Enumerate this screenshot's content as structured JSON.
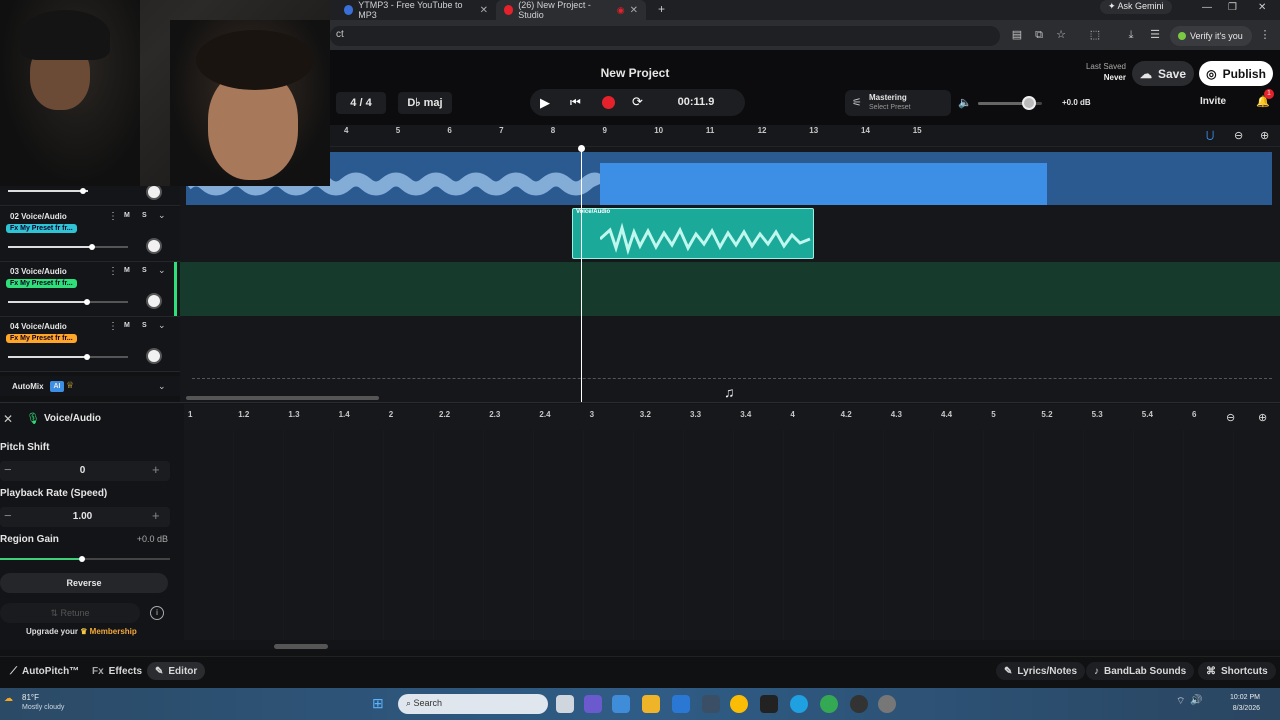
{
  "browser": {
    "tabs": [
      {
        "label": "YTMP3 - Free YouTube to MP3"
      },
      {
        "label": "(26) New Project - Studio"
      }
    ],
    "ask_gemini": "Ask Gemini",
    "url_fragment": "ct",
    "verify": "Verify it's you"
  },
  "header": {
    "title": "New Project",
    "last_saved_label": "Last Saved",
    "last_saved_value": "Never",
    "save": "Save",
    "publish": "Publish",
    "invite": "Invite",
    "notif_count": "1",
    "time_sig": "4 / 4",
    "key": "D♭ maj",
    "time": "00:11.9",
    "mastering_label": "Mastering",
    "mastering_sub": "Select Preset",
    "master_db": "+0.0 dB",
    "volume_level": 0.8
  },
  "ruler": {
    "ticks": [
      "4",
      "5",
      "6",
      "7",
      "8",
      "9",
      "10",
      "11",
      "12",
      "13",
      "14",
      "15"
    ]
  },
  "tracks": [
    {
      "name": "02 Voice/Audio",
      "fx": "Fx My Preset fr fr...",
      "m": "M",
      "s": "S",
      "color": "#2ec4d6",
      "volume": 0.7
    },
    {
      "name": "03 Voice/Audio",
      "fx": "Fx My Preset fr fr...",
      "m": "M",
      "s": "S",
      "color": "#2fe07a",
      "volume": 0.66
    },
    {
      "name": "04 Voice/Audio",
      "fx": "Fx My Preset fr fr...",
      "m": "M",
      "s": "S",
      "color": "#ffa528",
      "volume": 0.66
    }
  ],
  "clip_label": "Voice/Audio",
  "automix": "AutoMix",
  "automix_ai": "AI",
  "editor": {
    "track_title": "Voice/Audio",
    "ticks": [
      "1",
      "1.2",
      "1.3",
      "1.4",
      "2",
      "2.2",
      "2.3",
      "2.4",
      "3",
      "3.2",
      "3.3",
      "3.4",
      "4",
      "4.2",
      "4.3",
      "4.4",
      "5",
      "5.2",
      "5.3",
      "5.4",
      "6"
    ],
    "pitch_label": "Pitch Shift",
    "pitch_value": "0",
    "rate_label": "Playback Rate (Speed)",
    "rate_value": "1.00",
    "gain_label": "Region Gain",
    "gain_value": "+0.0 dB",
    "gain_level": 0.48,
    "reverse": "Reverse",
    "retune": "Retune",
    "upgrade_prefix": "Upgrade your",
    "upgrade_link": "Membership"
  },
  "footer": {
    "autopitch": "AutoPitch™",
    "effects": "Effects",
    "editor": "Editor",
    "lyrics": "Lyrics/Notes",
    "sounds": "BandLab Sounds",
    "shortcuts": "Shortcuts"
  },
  "taskbar": {
    "weather_temp": "81°F",
    "weather_desc": "Mostly cloudy",
    "search": "Search",
    "time": "10:02 PM",
    "date": "8/3/2026"
  },
  "colors": {
    "accent_blue": "#3d8fe6",
    "clip_teal": "#1ba99a",
    "record_red": "#e5222b"
  }
}
